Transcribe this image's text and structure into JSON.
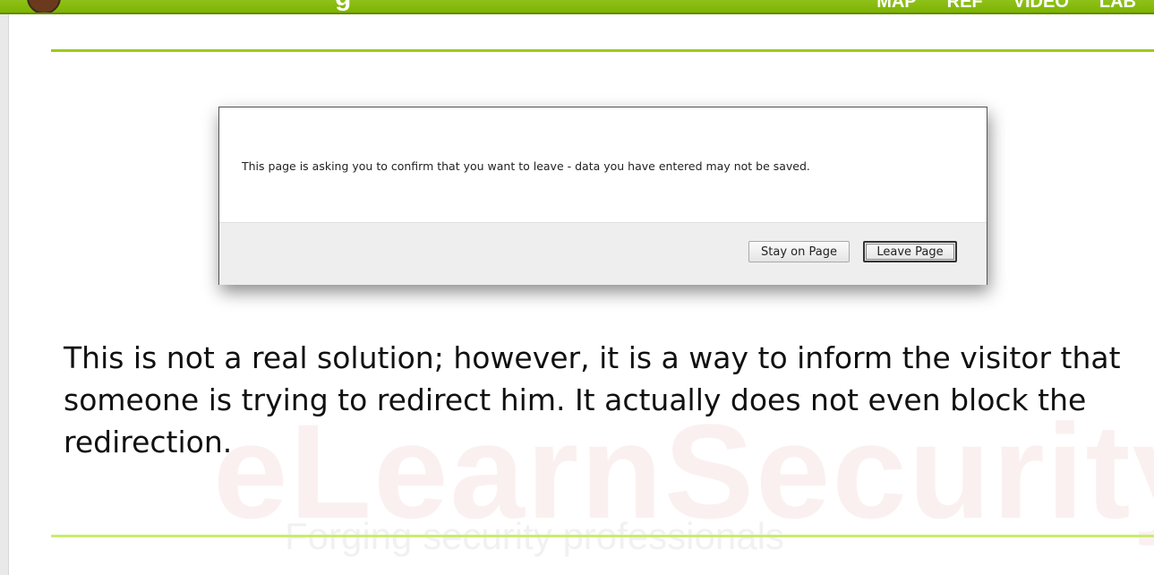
{
  "header": {
    "nav": [
      "MAP",
      "REF",
      "VIDEO",
      "LAB"
    ]
  },
  "watermark": {
    "brand": "eLearnSecurity",
    "tagline": "Forging security professionals"
  },
  "dialog": {
    "message": "This page is asking you to confirm that you want to leave - data you have entered may not be saved.",
    "stay_label": "Stay on Page",
    "leave_label": "Leave Page"
  },
  "slide": {
    "text": "This is not a real solution; however, it is a way to inform the visitor that someone is trying to redirect him. It actually does not even block the redirection."
  },
  "colors": {
    "accent_green": "#8fc21a",
    "rule_green": "#9dcb18"
  }
}
